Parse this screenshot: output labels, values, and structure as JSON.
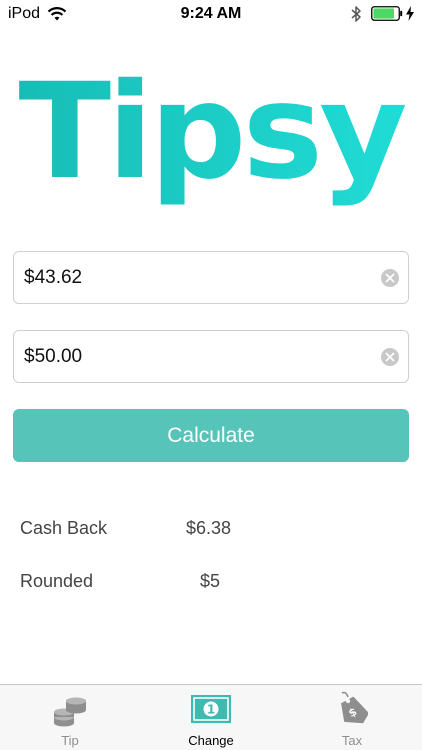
{
  "status_bar": {
    "carrier": "iPod",
    "time": "9:24 AM",
    "wifi_icon": "wifi-icon",
    "bluetooth_icon": "bluetooth-icon",
    "battery_icon": "battery-icon",
    "battery_fill_fraction": 0.85,
    "charging_icon": "charging-bolt-icon"
  },
  "app": {
    "logo_text": "Tipsy",
    "brand_color_start": "#17bdb5",
    "brand_color_end": "#20dcd6"
  },
  "form": {
    "amount_value": "$43.62",
    "paid_value": "$50.00",
    "clear_icon": "clear-circle-icon",
    "calculate_label": "Calculate",
    "button_color": "#56c4b9"
  },
  "results": {
    "cash_back_label": "Cash Back",
    "cash_back_value": "$6.38",
    "rounded_label": "Rounded",
    "rounded_value": "$5"
  },
  "tab_bar": {
    "tabs": [
      {
        "label": "Tip",
        "icon": "coins-icon",
        "active": false
      },
      {
        "label": "Change",
        "icon": "banknote-icon",
        "active": true
      },
      {
        "label": "Tax",
        "icon": "price-tag-icon",
        "active": false
      }
    ],
    "active_color": "#3fbab0"
  }
}
